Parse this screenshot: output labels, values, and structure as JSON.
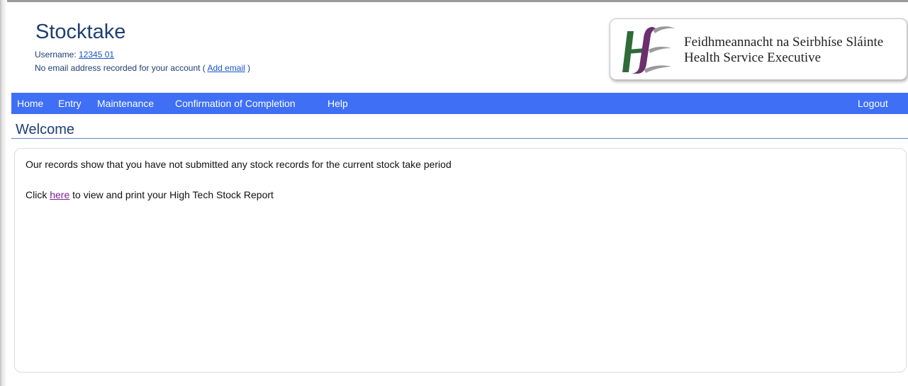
{
  "header": {
    "app_title": "Stocktake",
    "username_label": "Username: ",
    "username_value": "12345 01",
    "email_prefix": "No email address recorded for your account ( ",
    "email_link": "Add email",
    "email_suffix": " )"
  },
  "logo": {
    "line1": "Feidhmeannacht na Seirbhíse Sláinte",
    "line2": "Health Service Executive",
    "colors": {
      "green": "#2f6b3a",
      "purple": "#6b2f6e",
      "gray": "#9a9a9a"
    }
  },
  "nav": {
    "items": [
      "Home",
      "Entry",
      "Maintenance",
      "Confirmation of Completion",
      "Help"
    ],
    "logout": "Logout",
    "background": "#3e6ff5"
  },
  "main": {
    "title": "Welcome",
    "message": "Our records show that you have not submitted any stock records for the current stock take period",
    "report_prefix": "Click ",
    "report_link": "here",
    "report_suffix": " to view and print your High Tech Stock Report"
  }
}
